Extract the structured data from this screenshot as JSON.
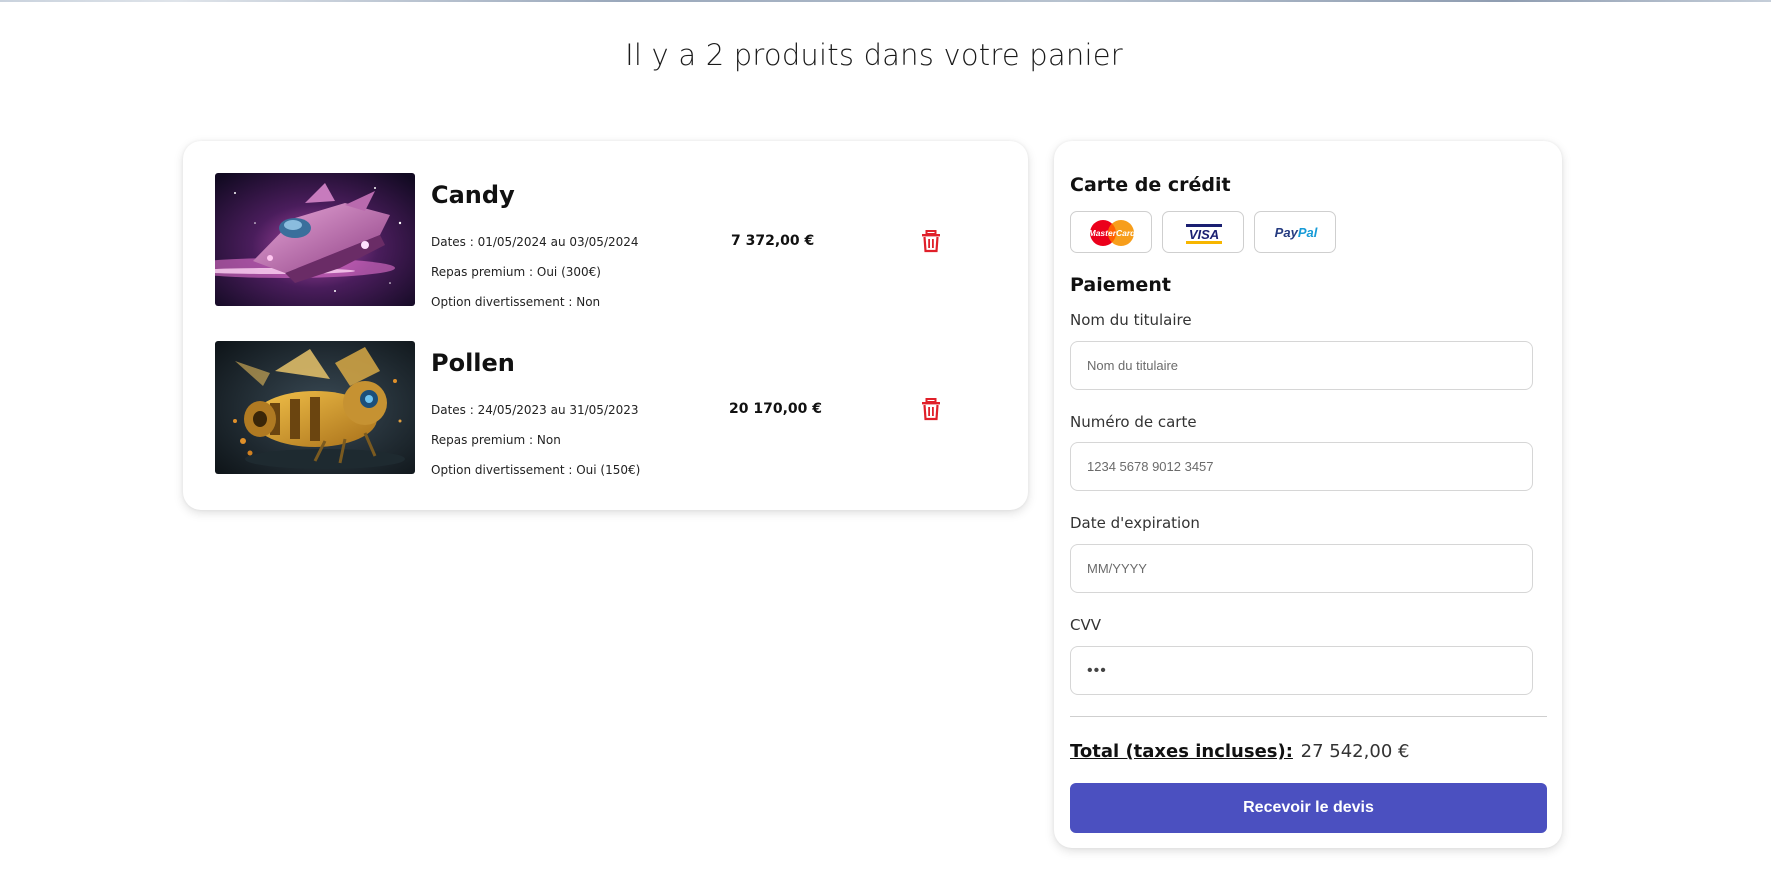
{
  "page": {
    "title": "Il y a 2 produits dans votre panier"
  },
  "cart": {
    "items": [
      {
        "name": "Candy",
        "dates": "Dates : 01/05/2024 au 03/05/2024",
        "repas": "Repas premium : Oui (300€)",
        "option": "Option divertissement : Non",
        "price": "7 372,00 €",
        "image_icon": "spaceship-image"
      },
      {
        "name": "Pollen",
        "dates": "Dates : 24/05/2023 au 31/05/2023",
        "repas": "Repas premium : Non",
        "option": "Option divertissement : Oui (150€)",
        "price": "20 170,00 €",
        "image_icon": "robot-bee-image"
      }
    ],
    "delete_icon": "trash-icon",
    "delete_color": "#e0202a"
  },
  "payment": {
    "credit_title": "Carte de crédit",
    "methods": [
      {
        "name": "MasterCard",
        "icon": "mastercard-icon"
      },
      {
        "name": "VISA",
        "icon": "visa-icon"
      },
      {
        "name": "PayPal",
        "icon": "paypal-icon"
      }
    ],
    "payment_title": "Paiement",
    "fields": {
      "holder": {
        "label": "Nom du titulaire",
        "placeholder": "Nom du titulaire"
      },
      "card_number": {
        "label": "Numéro de carte",
        "placeholder": "1234 5678 9012 3457"
      },
      "expiry": {
        "label": "Date d'expiration",
        "placeholder": "MM/YYYY"
      },
      "cvv": {
        "label": "CVV",
        "placeholder": "•••"
      }
    },
    "total_label": "Total (taxes incluses):",
    "total_value": "27 542,00 €",
    "submit_label": "Recevoir le devis",
    "accent_color": "#4b50c0"
  }
}
